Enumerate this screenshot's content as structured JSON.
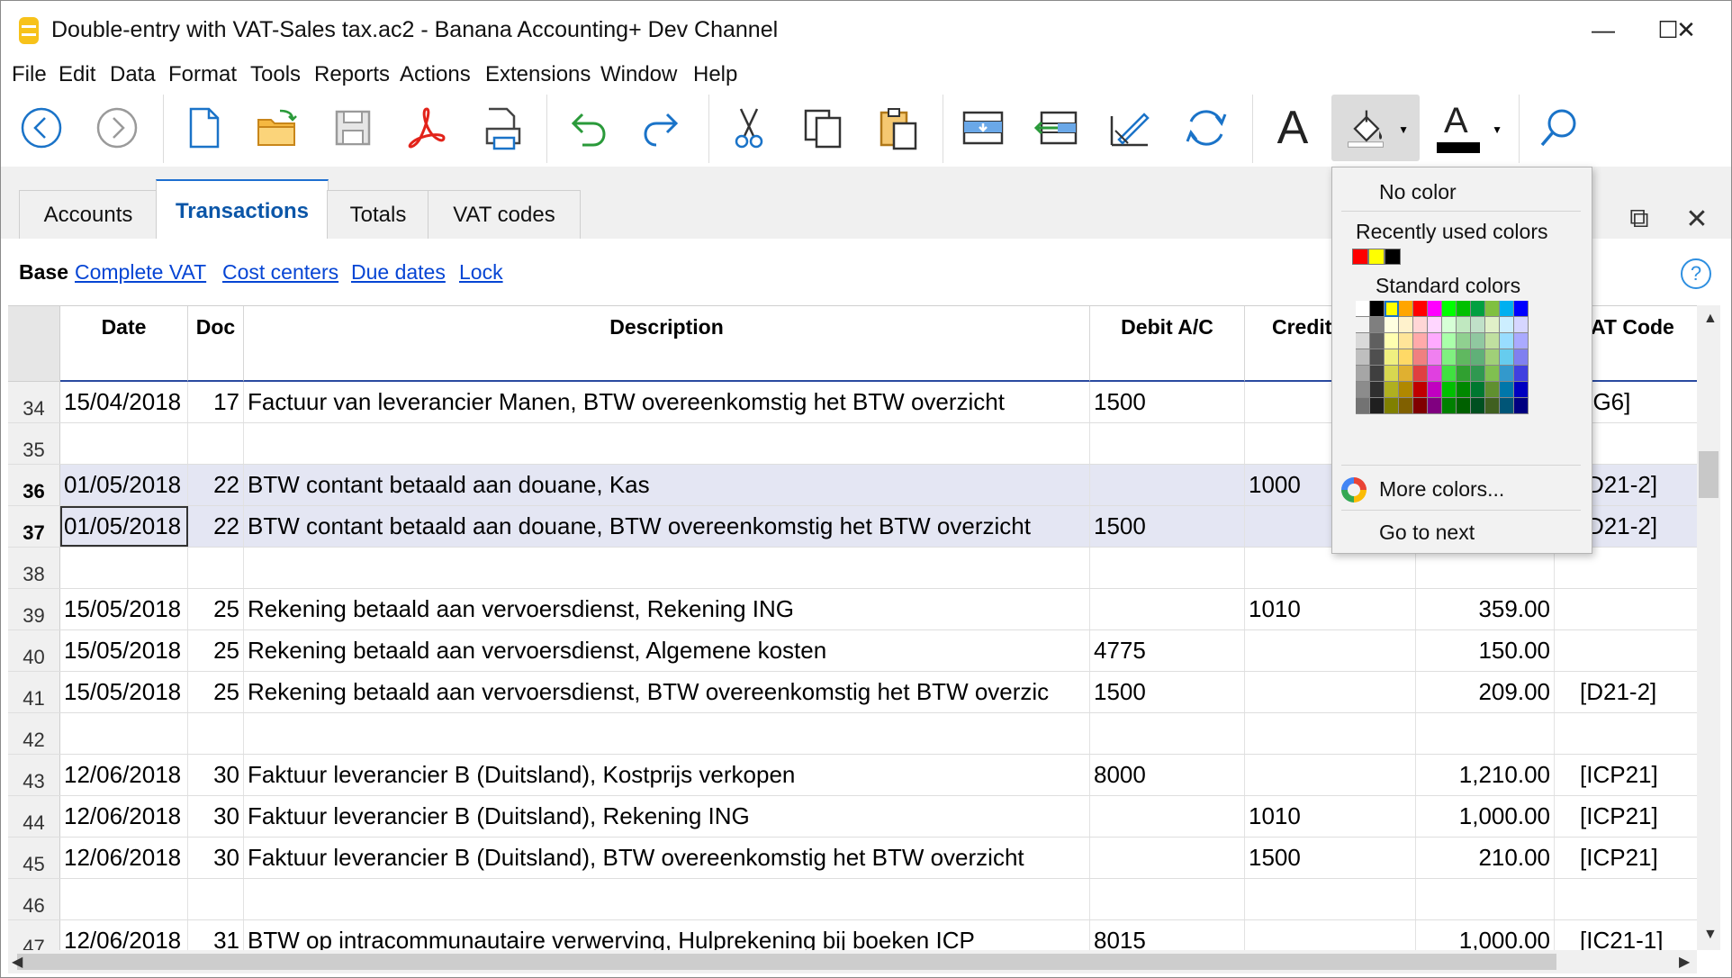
{
  "window": {
    "title": "Double-entry with VAT-Sales tax.ac2 - Banana Accounting+ Dev Channel",
    "minimize": "—",
    "maximize": "☐",
    "close": "✕"
  },
  "menu": [
    "File",
    "Edit",
    "Data",
    "Format",
    "Tools",
    "Reports",
    "Actions",
    "Extensions",
    "Window",
    "Help"
  ],
  "toolbar": {
    "icons": [
      "back-icon",
      "forward-icon",
      "new-file-icon",
      "open-folder-icon",
      "save-icon",
      "pdf-icon",
      "print-icon",
      "undo-icon",
      "redo-icon",
      "cut-icon",
      "copy-icon",
      "paste-icon",
      "insert-rows-icon",
      "move-rows-icon",
      "edit-icon",
      "recalculate-icon",
      "font-icon",
      "fill-color-icon",
      "text-color-icon",
      "search-icon"
    ],
    "font_glyph": "A",
    "text_color_glyph": "A"
  },
  "tabs": [
    {
      "label": "Accounts",
      "active": false
    },
    {
      "label": "Transactions",
      "active": true
    },
    {
      "label": "Totals",
      "active": false
    },
    {
      "label": "VAT codes",
      "active": false
    }
  ],
  "views": {
    "current": "Base",
    "links": [
      "Complete VAT",
      "Cost centers",
      "Due dates",
      "Lock"
    ],
    "help": "?"
  },
  "table": {
    "headers": {
      "date": "Date",
      "doc": "Doc",
      "description": "Description",
      "debit": "Debit A/C",
      "credit": "Credit",
      "vat": "AT Code"
    },
    "rows": [
      {
        "num": "34",
        "date": "15/04/2018",
        "doc": "17",
        "description": "Factuur van leverancier Manen, BTW overeenkomstig het BTW overzicht",
        "debit": "1500",
        "credit": "",
        "amount": "",
        "vat": "[IG6]",
        "selected": false
      },
      {
        "num": "35",
        "date": "",
        "doc": "",
        "description": "",
        "debit": "",
        "credit": "",
        "amount": "",
        "vat": "",
        "selected": false
      },
      {
        "num": "36",
        "date": "01/05/2018",
        "doc": "22",
        "description": "BTW contant betaald aan douane, Kas",
        "debit": "",
        "credit": "1000",
        "amount": "",
        "vat": "D21-2]",
        "selected": true
      },
      {
        "num": "37",
        "date": "01/05/2018",
        "doc": "22",
        "description": "BTW contant betaald aan douane, BTW overeenkomstig het BTW overzicht",
        "debit": "1500",
        "credit": "",
        "amount": "",
        "vat": "D21-2]",
        "selected": true
      },
      {
        "num": "38",
        "date": "",
        "doc": "",
        "description": "",
        "debit": "",
        "credit": "",
        "amount": "",
        "vat": "",
        "selected": false
      },
      {
        "num": "39",
        "date": "15/05/2018",
        "doc": "25",
        "description": "Rekening betaald aan vervoersdienst, Rekening ING",
        "debit": "",
        "credit": "1010",
        "amount": "359.00",
        "vat": "",
        "selected": false
      },
      {
        "num": "40",
        "date": "15/05/2018",
        "doc": "25",
        "description": "Rekening betaald aan vervoersdienst, Algemene kosten",
        "debit": "4775",
        "credit": "",
        "amount": "150.00",
        "vat": "",
        "selected": false
      },
      {
        "num": "41",
        "date": "15/05/2018",
        "doc": "25",
        "description": "Rekening betaald aan vervoersdienst, BTW overeenkomstig het BTW overzic",
        "debit": "1500",
        "credit": "",
        "amount": "209.00",
        "vat": "[D21-2]",
        "selected": false
      },
      {
        "num": "42",
        "date": "",
        "doc": "",
        "description": "",
        "debit": "",
        "credit": "",
        "amount": "",
        "vat": "",
        "selected": false
      },
      {
        "num": "43",
        "date": "12/06/2018",
        "doc": "30",
        "description": "Faktuur leverancier B (Duitsland), Kostprijs verkopen",
        "debit": "8000",
        "credit": "",
        "amount": "1,210.00",
        "vat": "[ICP21]",
        "selected": false
      },
      {
        "num": "44",
        "date": "12/06/2018",
        "doc": "30",
        "description": "Faktuur leverancier B (Duitsland), Rekening ING",
        "debit": "",
        "credit": "1010",
        "amount": "1,000.00",
        "vat": "[ICP21]",
        "selected": false
      },
      {
        "num": "45",
        "date": "12/06/2018",
        "doc": "30",
        "description": "Faktuur leverancier B (Duitsland), BTW overeenkomstig het BTW overzicht",
        "debit": "",
        "credit": "1500",
        "amount": "210.00",
        "vat": "[ICP21]",
        "selected": false
      },
      {
        "num": "46",
        "date": "",
        "doc": "",
        "description": "",
        "debit": "",
        "credit": "",
        "amount": "",
        "vat": "",
        "selected": false
      },
      {
        "num": "47",
        "date": "12/06/2018",
        "doc": "31",
        "description": "BTW op intracommunautaire verwerving, Hulprekening bij boeken ICP",
        "debit": "8015",
        "credit": "",
        "amount": "1,000.00",
        "vat": "[IC21-1]",
        "selected": false
      }
    ]
  },
  "color_menu": {
    "no_color": "No color",
    "recent_title": "Recently used colors",
    "recent": [
      "#ff0000",
      "#ffff00",
      "#000000"
    ],
    "standard_title": "Standard colors",
    "palette_top": [
      "#ffffff",
      "#000000",
      "#ffff00",
      "#ffa500",
      "#ff0000",
      "#ff00ff",
      "#00ff00",
      "#00c000",
      "#00a040",
      "#80c040",
      "#00b0f0",
      "#0000ff"
    ],
    "palette_columns": [
      [
        "#f2f2f2",
        "#d9d9d9",
        "#bfbfbf",
        "#a6a6a6",
        "#8c8c8c",
        "#737373"
      ],
      [
        "#7f7f7f",
        "#5f5f5f",
        "#4f4f4f",
        "#3f3f3f",
        "#2f2f2f",
        "#1f1f1f"
      ],
      [
        "#ffffe0",
        "#ffffb0",
        "#f0f080",
        "#d8d850",
        "#b0b020",
        "#808000"
      ],
      [
        "#fff2cc",
        "#ffe599",
        "#ffd966",
        "#e0b030",
        "#b08800",
        "#806000"
      ],
      [
        "#ffd6d6",
        "#ffaaaa",
        "#f08080",
        "#e04040",
        "#c00000",
        "#800000"
      ],
      [
        "#ffd6ff",
        "#ffaaff",
        "#f080f0",
        "#e040e0",
        "#c000c0",
        "#800080"
      ],
      [
        "#d6ffd6",
        "#aaffaa",
        "#80f080",
        "#40e040",
        "#00c000",
        "#008000"
      ],
      [
        "#c0e8c0",
        "#90d090",
        "#60b860",
        "#30a030",
        "#008800",
        "#006000"
      ],
      [
        "#c0e0c8",
        "#90c8a0",
        "#60b078",
        "#309850",
        "#007830",
        "#005020"
      ],
      [
        "#e0f0c8",
        "#c0e0a0",
        "#a0d078",
        "#80c050",
        "#609030",
        "#406020"
      ],
      [
        "#cceeff",
        "#99ddff",
        "#66ccee",
        "#3399cc",
        "#0077aa",
        "#005577"
      ],
      [
        "#d6d6ff",
        "#aaaaff",
        "#8080f0",
        "#4040e0",
        "#0000c0",
        "#000080"
      ]
    ],
    "more_colors": "More colors...",
    "go_to_next": "Go to next"
  }
}
